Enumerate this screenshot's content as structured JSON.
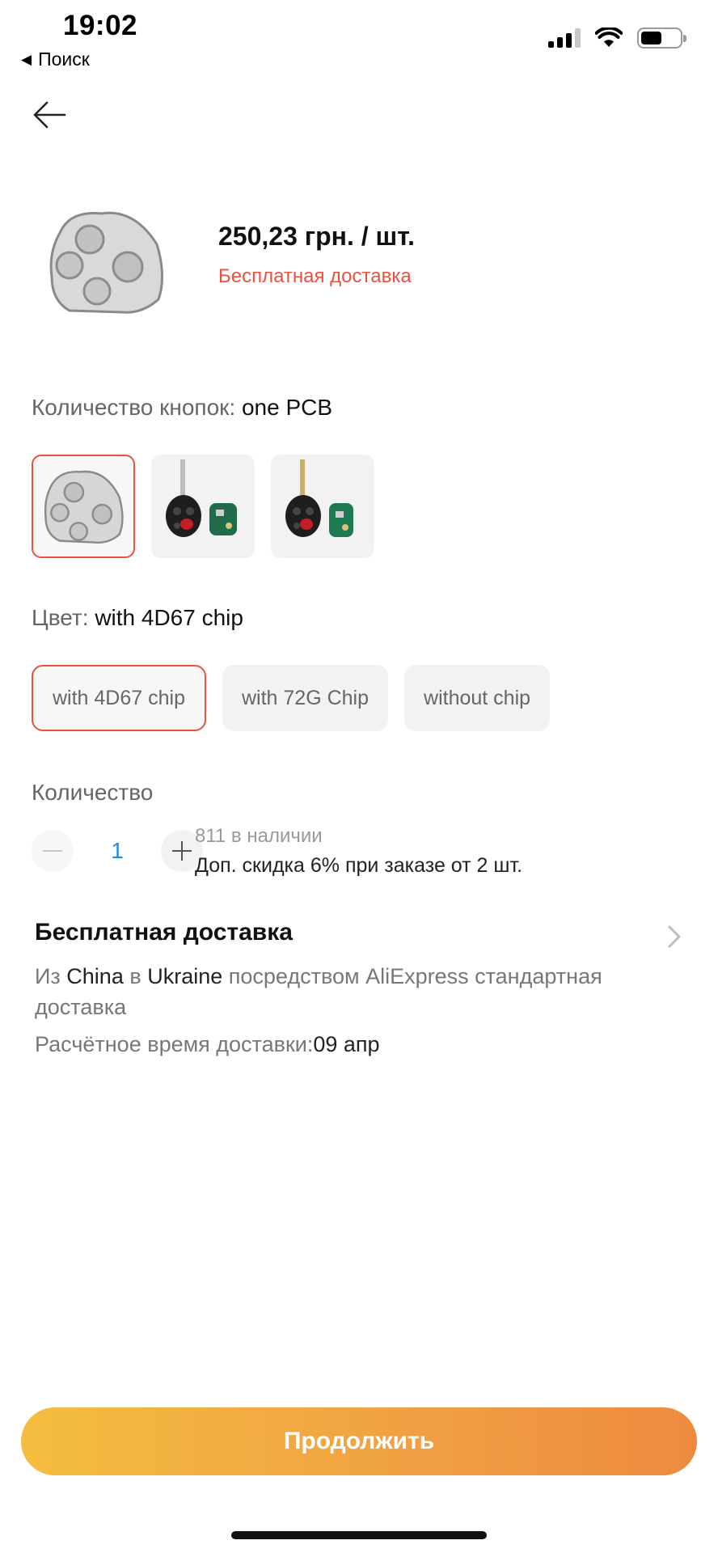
{
  "status_bar": {
    "time": "19:02",
    "back_app_label": "Поиск"
  },
  "product": {
    "price": "250,23 грн. / шт.",
    "shipping_badge": "Бесплатная доставка"
  },
  "buttons_option": {
    "label": "Количество кнопок: ",
    "selected_value": "one PCB",
    "tiles": [
      {
        "icon": "key-fob-pcb-image",
        "selected": true
      },
      {
        "icon": "flip-key-with-pcb-image",
        "selected": false
      },
      {
        "icon": "flip-key-with-pcb-image",
        "selected": false
      }
    ]
  },
  "color_option": {
    "label": "Цвет: ",
    "selected_value": "with 4D67 chip",
    "chips": [
      {
        "label": "with 4D67 chip",
        "selected": true
      },
      {
        "label": "with 72G Chip",
        "selected": false
      },
      {
        "label": "without chip",
        "selected": false
      }
    ]
  },
  "quantity": {
    "label": "Количество",
    "value": "1",
    "stock": "811 в наличии",
    "discount": "Доп. скидка 6% при заказе от 2 шт."
  },
  "delivery": {
    "title": "Бесплатная доставка",
    "route_from_prefix": "Из ",
    "from": "China",
    "route_in": " в ",
    "to": "Ukraine",
    "route_suffix": " посредством AliExpress стандартная доставка",
    "eta_label": "Расчётное время доставки:",
    "eta_value": "09 апр"
  },
  "actions": {
    "continue_label": "Продолжить"
  },
  "colors": {
    "accent_red": "#e8533f",
    "button_gradient_start": "#f4bd3f",
    "button_gradient_end": "#ee8a3f",
    "quantity_blue": "#2a8bd6"
  }
}
